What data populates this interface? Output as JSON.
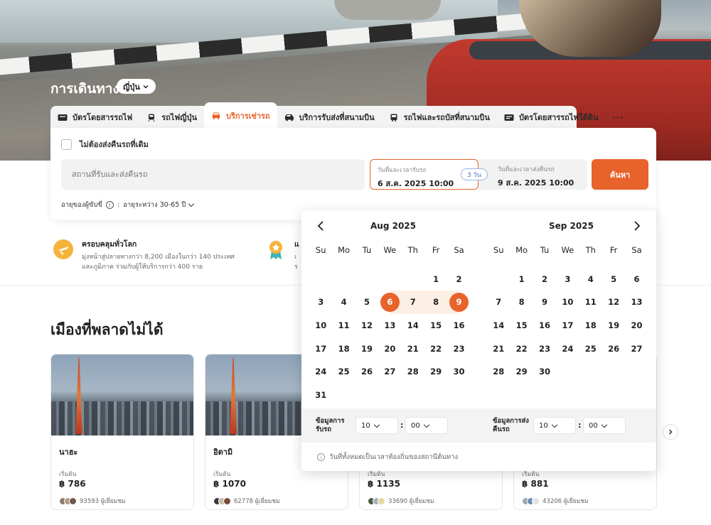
{
  "hero": {
    "title": "การเดินทาง",
    "country": "ญี่ปุ่น"
  },
  "tabs": [
    {
      "label": "บัตรโดยสารรถไฟ",
      "icon": "ticket-icon"
    },
    {
      "label": "รถไฟญี่ปุ่น",
      "icon": "train-icon"
    },
    {
      "label": "บริการเช่ารถ",
      "icon": "car-icon",
      "active": true
    },
    {
      "label": "บริการรับส่งที่สนามบิน",
      "icon": "shuttle-icon"
    },
    {
      "label": "รถไฟและรถบัสที่สนามบิน",
      "icon": "bus-icon"
    },
    {
      "label": "บัตรโดยสารรถไฟใต้ดิน",
      "icon": "subway-ticket-icon"
    }
  ],
  "tabs_more": "···",
  "search": {
    "no_return_label": "ไม่ต้องส่งคืนรถที่เดิม",
    "location_placeholder": "สถานที่รับและส่งคืนรถ",
    "pickup_label": "วันที่และเวลารับรถ",
    "pickup_value": "6 ส.ค. 2025 10:00",
    "return_label": "วันที่และเวลาส่งคืนรถ",
    "return_value": "9 ส.ค. 2025 10:00",
    "days": "3 วัน",
    "button": "ค้นหา",
    "age_label": "อายุของผู้ขับขี่",
    "age_value": "อายุระหว่าง 30-65 ปี"
  },
  "features": [
    {
      "title": "ครอบคลุมทั่วโลก",
      "desc1": "มุ่งหน้าสู่ปลายทางกว่า 8,200 เมืองในกว่า 140 ประเทศ",
      "desc2": "และภูมิภาค ร่วมกับผู้ให้บริการกว่า 400 ราย"
    },
    {
      "title": "แ",
      "desc1": "เ",
      "desc2": "ร"
    }
  ],
  "section_title": "เมืองที่พลาดไม่ได้",
  "cards": [
    {
      "name": "นาฮะ",
      "from": "เริ่มต้น",
      "price": "฿ 786",
      "visitors": "93593 ผู้เยี่ยมชม"
    },
    {
      "name": "อิตามิ",
      "from": "เริ่มต้น",
      "price": "฿ 1070",
      "visitors": "62778 ผู้เยี่ยมชม"
    },
    {
      "name": "",
      "from": "เริ่มต้น",
      "price": "฿ 1135",
      "visitors": "33690 ผู้เยี่ยมชม"
    },
    {
      "name": "",
      "from": "เริ่มต้น",
      "price": "฿ 881",
      "visitors": "43206 ผู้เยี่ยมชม"
    }
  ],
  "calendar": {
    "weekdays": [
      "Su",
      "Mo",
      "Tu",
      "We",
      "Th",
      "Fr",
      "Sa"
    ],
    "months": [
      {
        "title": "Aug 2025",
        "offset": 5,
        "days": 31
      },
      {
        "title": "Sep 2025",
        "offset": 1,
        "days": 30
      }
    ],
    "selected_start": 6,
    "selected_end": 9,
    "pickup_time_label": "ข้อมูลการรับรถ",
    "return_time_label": "ข้อมูลการส่งคืนรถ",
    "pickup_hour": "10",
    "pickup_minute": "00",
    "return_hour": "10",
    "return_minute": "00",
    "colon": ":",
    "note": "วันที่ทั้งหมดเป็นเวลาท้องถิ่นของสถานีต้นทาง"
  },
  "colors": {
    "accent": "#e8632c",
    "range": "#fcefe4"
  }
}
